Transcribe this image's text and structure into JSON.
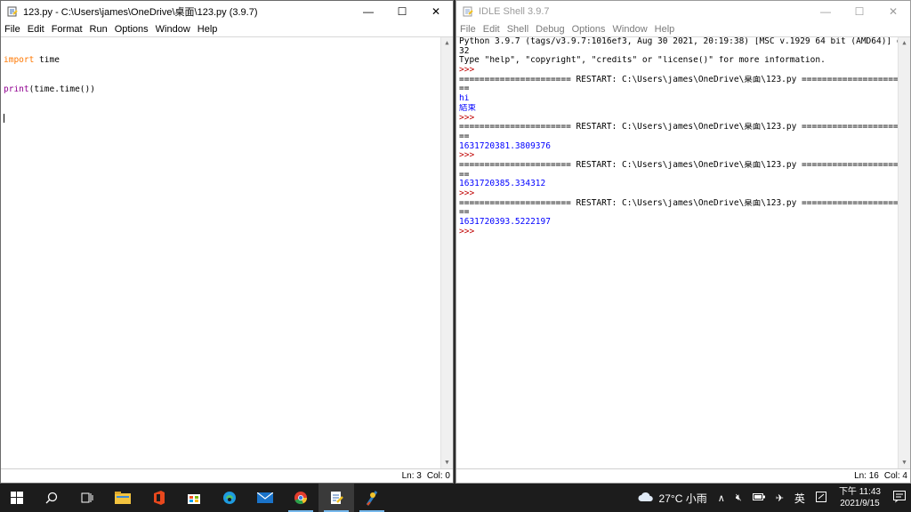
{
  "editor": {
    "title": "123.py - C:\\Users\\james\\OneDrive\\桌面\\123.py (3.9.7)",
    "menu": [
      "File",
      "Edit",
      "Format",
      "Run",
      "Options",
      "Window",
      "Help"
    ],
    "code": {
      "kw_import": "import",
      "mod": " time",
      "bi_print": "print",
      "rest": "(time.time())"
    },
    "status": {
      "ln": "Ln: 3",
      "col": "Col: 0"
    }
  },
  "shell": {
    "title": "IDLE Shell 3.9.7",
    "menu": [
      "File",
      "Edit",
      "Shell",
      "Debug",
      "Options",
      "Window",
      "Help"
    ],
    "lines": [
      {
        "t": "Python 3.9.7 (tags/v3.9.7:1016ef3, Aug 30 2021, 20:19:38) [MSC v.1929 64 bit (AMD64)] on win",
        "c": ""
      },
      {
        "t": "32",
        "c": ""
      },
      {
        "t": "Type \"help\", \"copyright\", \"credits\" or \"license()\" for more information.",
        "c": ""
      },
      {
        "t": ">>> ",
        "c": "pr"
      },
      {
        "t": "====================== RESTART: C:\\Users\\james\\OneDrive\\桌面\\123.py ======================",
        "c": ""
      },
      {
        "t": "==",
        "c": ""
      },
      {
        "t": "hi",
        "c": "out"
      },
      {
        "t": "結束",
        "c": "out"
      },
      {
        "t": ">>> ",
        "c": "pr"
      },
      {
        "t": "====================== RESTART: C:\\Users\\james\\OneDrive\\桌面\\123.py ======================",
        "c": ""
      },
      {
        "t": "==",
        "c": ""
      },
      {
        "t": "1631720381.3809376",
        "c": "out"
      },
      {
        "t": ">>> ",
        "c": "pr"
      },
      {
        "t": "====================== RESTART: C:\\Users\\james\\OneDrive\\桌面\\123.py ======================",
        "c": ""
      },
      {
        "t": "==",
        "c": ""
      },
      {
        "t": "1631720385.334312",
        "c": "out"
      },
      {
        "t": ">>> ",
        "c": "pr"
      },
      {
        "t": "====================== RESTART: C:\\Users\\james\\OneDrive\\桌面\\123.py ======================",
        "c": ""
      },
      {
        "t": "==",
        "c": ""
      },
      {
        "t": "1631720393.5222197",
        "c": "out"
      },
      {
        "t": ">>> ",
        "c": "pr"
      }
    ],
    "status": {
      "ln": "Ln: 16",
      "col": "Col: 4"
    }
  },
  "taskbar": {
    "weather": "27°C 小雨",
    "ime": "英",
    "time": "下午 11:43",
    "date": "2021/9/15"
  },
  "colors": {
    "keyword": "#ff7700",
    "builtin": "#900090",
    "output": "#0000ff",
    "prompt": "#c00000",
    "accent": "#76b9ed"
  }
}
